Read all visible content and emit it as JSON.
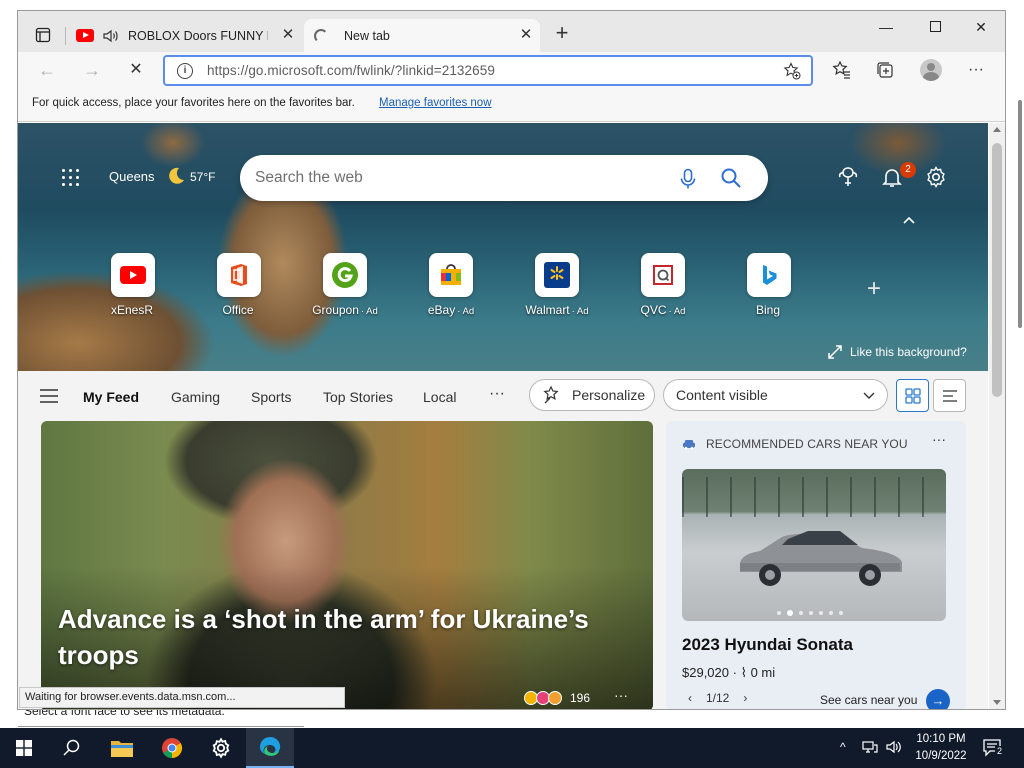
{
  "browser": {
    "tabs": [
      {
        "title": "ROBLOX Doors FUNNY MOMENTS",
        "active": false
      },
      {
        "title": "New tab",
        "active": true
      }
    ],
    "url": "https://go.microsoft.com/fwlink/?linkid=2132659",
    "favorites_bar": {
      "message": "For quick access, place your favorites here on the favorites bar.",
      "link": "Manage favorites now"
    },
    "status_tip": "Waiting for browser.events.data.msn.com..."
  },
  "newtab": {
    "weather": {
      "city": "Queens",
      "temp": "57°F"
    },
    "search_placeholder": "Search the web",
    "notification_count": "2",
    "tiles": [
      {
        "label": "xEnesR",
        "ad": "",
        "icon": "youtube-icon"
      },
      {
        "label": "Office",
        "ad": "",
        "icon": "office-icon"
      },
      {
        "label": "Groupon",
        "ad": "· Ad",
        "icon": "groupon-icon"
      },
      {
        "label": "eBay",
        "ad": "· Ad",
        "icon": "ebay-icon"
      },
      {
        "label": "Walmart",
        "ad": "· Ad",
        "icon": "walmart-icon"
      },
      {
        "label": "QVC",
        "ad": "· Ad",
        "icon": "qvc-icon"
      },
      {
        "label": "Bing",
        "ad": "",
        "icon": "bing-icon"
      }
    ],
    "like_background": "Like this background?"
  },
  "feed": {
    "tabs": [
      "My Feed",
      "Gaming",
      "Sports",
      "Top Stories",
      "Local"
    ],
    "active_tab": "My Feed",
    "personalize": "Personalize",
    "content_visibility": "Content visible",
    "headline": "Advance is a ‘shot in the arm’ for Ukraine’s troops",
    "reaction_count": "196"
  },
  "cars_card": {
    "header": "RECOMMENDED CARS NEAR YOU",
    "title": "2023 Hyundai Sonata",
    "price": "$29,020",
    "mileage": "0 mi",
    "pager": "1/12",
    "cta": "See cars near you"
  },
  "desktop": {
    "behind_text": "Select a font face to see its metadata."
  },
  "taskbar": {
    "time": "10:10 PM",
    "date": "10/9/2022",
    "notification_count": "2"
  },
  "colors": {
    "accent": "#1a64c7",
    "address_focus": "#5a8dee",
    "badge": "#d83b01",
    "taskbar": "#101a2a"
  }
}
